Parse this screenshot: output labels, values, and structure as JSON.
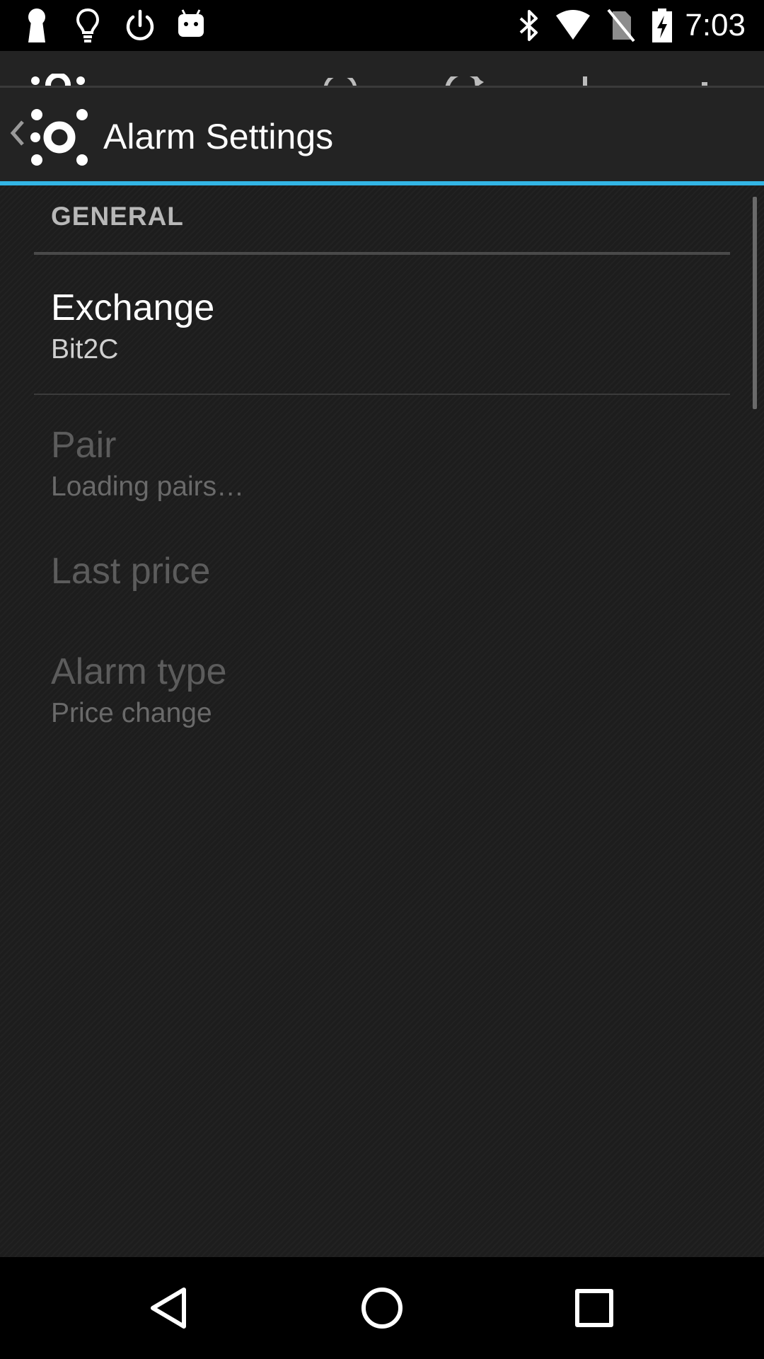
{
  "status_bar": {
    "time": "7:03",
    "left_icons": [
      "keyhole-icon",
      "lightbulb-icon",
      "power-icon",
      "android-icon"
    ],
    "right_icons": [
      "bluetooth-icon",
      "wifi-icon",
      "no-sim-icon",
      "battery-charging-icon"
    ]
  },
  "action_bar": {
    "title": "Alarm Settings",
    "accent_color": "#33b5e5",
    "icons": [
      "up-caret-icon",
      "app-logo-icon"
    ]
  },
  "preferences": {
    "category": "GENERAL",
    "items": [
      {
        "title": "Exchange",
        "summary": "Bit2C",
        "enabled": true
      },
      {
        "title": "Pair",
        "summary": "Loading pairs…",
        "enabled": false
      },
      {
        "title": "Last price",
        "summary": "",
        "enabled": false
      },
      {
        "title": "Alarm type",
        "summary": "Price change",
        "enabled": false
      }
    ]
  },
  "nav_bar": {
    "icons": [
      "back-icon",
      "home-icon",
      "recents-icon"
    ]
  }
}
